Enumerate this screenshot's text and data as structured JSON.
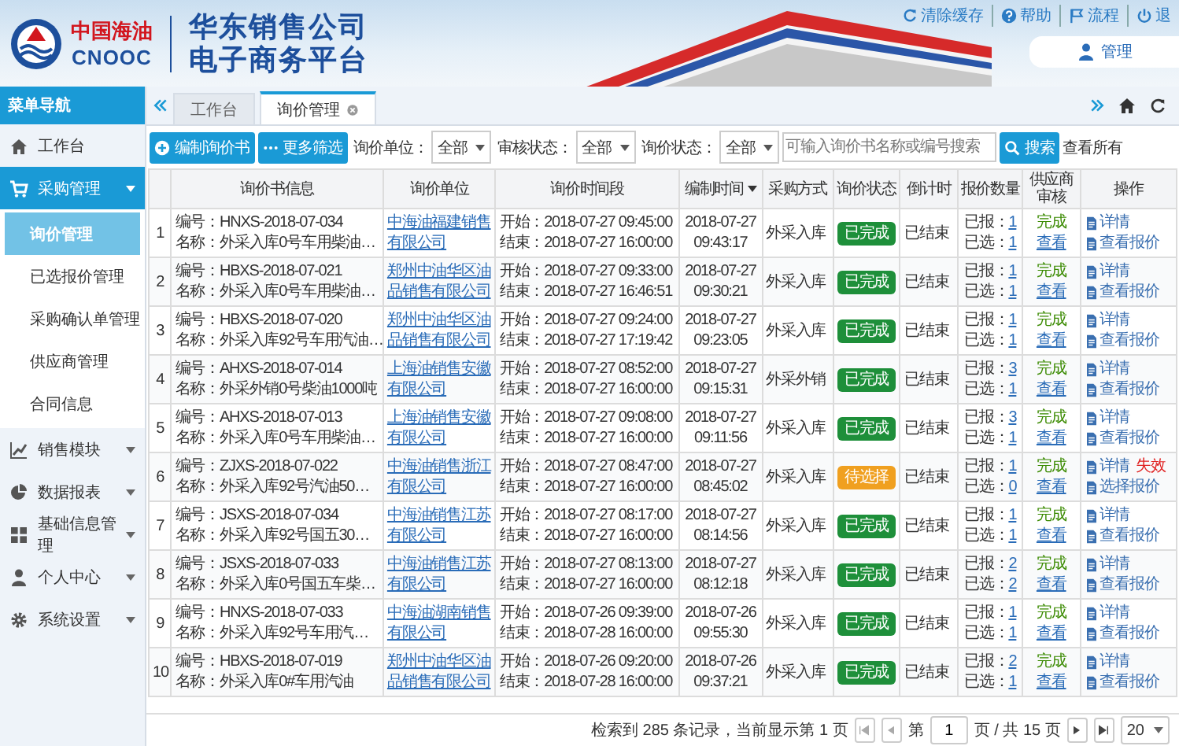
{
  "header": {
    "logo_cn": "中国海油",
    "logo_en": "CNOOC",
    "title_lines": [
      "华东销售公司",
      "电子商务平台"
    ],
    "links": [
      {
        "label": "清除缓存"
      },
      {
        "label": "帮助"
      },
      {
        "label": "流程"
      },
      {
        "label": "退"
      }
    ],
    "user": "管理"
  },
  "sidebar": {
    "title": "菜单导航",
    "items": [
      {
        "label": "工作台",
        "kind": "link",
        "selected": false
      },
      {
        "label": "采购管理",
        "kind": "group",
        "selected": true,
        "expanded": true,
        "children": [
          {
            "label": "询价管理",
            "selected": true
          },
          {
            "label": "已选报价管理",
            "selected": false
          },
          {
            "label": "采购确认单管理",
            "selected": false
          },
          {
            "label": "供应商管理",
            "selected": false
          },
          {
            "label": "合同信息",
            "selected": false
          }
        ]
      },
      {
        "label": "销售模块",
        "kind": "group",
        "selected": false,
        "expanded": false
      },
      {
        "label": "数据报表",
        "kind": "group",
        "selected": false,
        "expanded": false
      },
      {
        "label": "基础信息管理",
        "kind": "group",
        "selected": false,
        "expanded": false
      },
      {
        "label": "个人中心",
        "kind": "group",
        "selected": false,
        "expanded": false
      },
      {
        "label": "系统设置",
        "kind": "group",
        "selected": false,
        "expanded": false
      }
    ]
  },
  "tabs": [
    {
      "label": "工作台",
      "selected": false,
      "closable": false
    },
    {
      "label": "询价管理",
      "selected": true,
      "closable": true
    }
  ],
  "toolbar": {
    "buttons": [
      {
        "label": "编制询价书"
      },
      {
        "label": "更多筛选"
      }
    ],
    "filters": [
      {
        "label": "询价单位：",
        "value": "全部"
      },
      {
        "label": "审核状态：",
        "value": "全部"
      },
      {
        "label": "询价状态：",
        "value": "全部"
      }
    ],
    "search": {
      "placeholder": "可输入询价书名称或编号搜索",
      "button": "搜索"
    },
    "view_all": "查看所有"
  },
  "table": {
    "columns": [
      {
        "label": "询价书信息",
        "sorted": false
      },
      {
        "label": "询价单位",
        "sorted": false
      },
      {
        "label": "询价时间段",
        "sorted": false
      },
      {
        "label": "编制时间",
        "sorted": true
      },
      {
        "label": "采购方式",
        "sorted": false
      },
      {
        "label": "询价状态",
        "sorted": false
      },
      {
        "label": "倒计时",
        "sorted": false
      },
      {
        "label": "报价数量",
        "sorted": false
      },
      {
        "label": "供应商审核",
        "sorted": false
      },
      {
        "label": "操作",
        "sorted": false
      }
    ],
    "rows": [
      {
        "index": "1",
        "code": "编号：HNXS-2018-07-034",
        "name": "名称：外采入库0号车用柴油…",
        "unit": "中海油福建销售有限公司",
        "start": "开始：2018-07-27 09:45:00",
        "end": "结束：2018-07-27 16:00:00",
        "created_date": "2018-07-27",
        "created_time": "09:43:17",
        "method": "外采入库",
        "status": "已完成",
        "pending": false,
        "countdown": "已结束",
        "quoted_label": "已报：",
        "quoted": "1",
        "chosen_label": "已选：",
        "chosen": "1",
        "supplier_status": "完成",
        "supplier_link": "查看",
        "actions": [
          "详情",
          "查看报价"
        ]
      },
      {
        "index": "2",
        "code": "编号：HBXS-2018-07-021",
        "name": "名称：外采入库0号车用柴油…",
        "unit": "郑州中油华区油品销售有限公司",
        "start": "开始：2018-07-27 09:33:00",
        "end": "结束：2018-07-27 16:46:51",
        "created_date": "2018-07-27",
        "created_time": "09:30:21",
        "method": "外采入库",
        "status": "已完成",
        "pending": false,
        "countdown": "已结束",
        "quoted_label": "已报：",
        "quoted": "1",
        "chosen_label": "已选：",
        "chosen": "1",
        "supplier_status": "完成",
        "supplier_link": "查看",
        "actions": [
          "详情",
          "查看报价"
        ]
      },
      {
        "index": "3",
        "code": "编号：HBXS-2018-07-020",
        "name": "名称：外采入库92号车用汽油…",
        "unit": "郑州中油华区油品销售有限公司",
        "start": "开始：2018-07-27 09:24:00",
        "end": "结束：2018-07-27 17:19:42",
        "created_date": "2018-07-27",
        "created_time": "09:23:05",
        "method": "外采入库",
        "status": "已完成",
        "pending": false,
        "countdown": "已结束",
        "quoted_label": "已报：",
        "quoted": "1",
        "chosen_label": "已选：",
        "chosen": "1",
        "supplier_status": "完成",
        "supplier_link": "查看",
        "actions": [
          "详情",
          "查看报价"
        ]
      },
      {
        "index": "4",
        "code": "编号：AHXS-2018-07-014",
        "name": "名称：外采外销0号柴油1000吨",
        "unit": "上海油销售安徽有限公司",
        "start": "开始：2018-07-27 08:52:00",
        "end": "结束：2018-07-27 16:00:00",
        "created_date": "2018-07-27",
        "created_time": "09:15:31",
        "method": "外采外销",
        "status": "已完成",
        "pending": false,
        "countdown": "已结束",
        "quoted_label": "已报：",
        "quoted": "3",
        "chosen_label": "已选：",
        "chosen": "1",
        "supplier_status": "完成",
        "supplier_link": "查看",
        "actions": [
          "详情",
          "查看报价"
        ]
      },
      {
        "index": "5",
        "code": "编号：AHXS-2018-07-013",
        "name": "名称：外采入库0号车用柴油…",
        "unit": "上海油销售安徽有限公司",
        "start": "开始：2018-07-27 09:08:00",
        "end": "结束：2018-07-27 16:00:00",
        "created_date": "2018-07-27",
        "created_time": "09:11:56",
        "method": "外采入库",
        "status": "已完成",
        "pending": false,
        "countdown": "已结束",
        "quoted_label": "已报：",
        "quoted": "3",
        "chosen_label": "已选：",
        "chosen": "1",
        "supplier_status": "完成",
        "supplier_link": "查看",
        "actions": [
          "详情",
          "查看报价"
        ]
      },
      {
        "index": "6",
        "code": "编号：ZJXS-2018-07-022",
        "name": "名称：外采入库92号汽油50…",
        "unit": "中海油销售浙江有限公司",
        "start": "开始：2018-07-27 08:47:00",
        "end": "结束：2018-07-27 16:00:00",
        "created_date": "2018-07-27",
        "created_time": "08:45:02",
        "method": "外采入库",
        "status": "待选择",
        "pending": true,
        "countdown": "已结束",
        "quoted_label": "已报：",
        "quoted": "1",
        "chosen_label": "已选：",
        "chosen": "0",
        "supplier_status": "完成",
        "supplier_link": "查看",
        "actions": [
          "详情",
          "选择报价"
        ],
        "extra_action": "失效"
      },
      {
        "index": "7",
        "code": "编号：JSXS-2018-07-034",
        "name": "名称：外采入库92号国五30…",
        "unit": "中海油销售江苏有限公司",
        "start": "开始：2018-07-27 08:17:00",
        "end": "结束：2018-07-27 16:00:00",
        "created_date": "2018-07-27",
        "created_time": "08:14:56",
        "method": "外采入库",
        "status": "已完成",
        "pending": false,
        "countdown": "已结束",
        "quoted_label": "已报：",
        "quoted": "1",
        "chosen_label": "已选：",
        "chosen": "1",
        "supplier_status": "完成",
        "supplier_link": "查看",
        "actions": [
          "详情",
          "查看报价"
        ]
      },
      {
        "index": "8",
        "code": "编号：JSXS-2018-07-033",
        "name": "名称：外采入库0号国五车柴…",
        "unit": "中海油销售江苏有限公司",
        "start": "开始：2018-07-27 08:13:00",
        "end": "结束：2018-07-27 16:00:00",
        "created_date": "2018-07-27",
        "created_time": "08:12:18",
        "method": "外采入库",
        "status": "已完成",
        "pending": false,
        "countdown": "已结束",
        "quoted_label": "已报：",
        "quoted": "2",
        "chosen_label": "已选：",
        "chosen": "2",
        "supplier_status": "完成",
        "supplier_link": "查看",
        "actions": [
          "详情",
          "查看报价"
        ]
      },
      {
        "index": "9",
        "code": "编号：HNXS-2018-07-033",
        "name": "名称：外采入库92号车用汽…",
        "unit": "中海油湖南销售有限公司",
        "start": "开始：2018-07-26 09:39:00",
        "end": "结束：2018-07-28 16:00:00",
        "created_date": "2018-07-26",
        "created_time": "09:55:30",
        "method": "外采入库",
        "status": "已完成",
        "pending": false,
        "countdown": "已结束",
        "quoted_label": "已报：",
        "quoted": "1",
        "chosen_label": "已选：",
        "chosen": "1",
        "supplier_status": "完成",
        "supplier_link": "查看",
        "actions": [
          "详情",
          "查看报价"
        ]
      },
      {
        "index": "10",
        "code": "编号：HBXS-2018-07-019",
        "name": "名称：外采入库0#车用汽油",
        "unit": "郑州中油华区油品销售有限公司",
        "start": "开始：2018-07-26 09:20:00",
        "end": "结束：2018-07-28 16:00:00",
        "created_date": "2018-07-26",
        "created_time": "09:37:21",
        "method": "外采入库",
        "status": "已完成",
        "pending": false,
        "countdown": "已结束",
        "quoted_label": "已报：",
        "quoted": "2",
        "chosen_label": "已选：",
        "chosen": "1",
        "supplier_status": "完成",
        "supplier_link": "查看",
        "actions": [
          "详情",
          "查看报价"
        ]
      }
    ]
  },
  "pagination": {
    "summary": "检索到 285 条记录，当前显示第 1 页",
    "page_prefix": "第",
    "page": "1",
    "page_suffix": "页 / 共 15 页",
    "page_size": "20"
  }
}
